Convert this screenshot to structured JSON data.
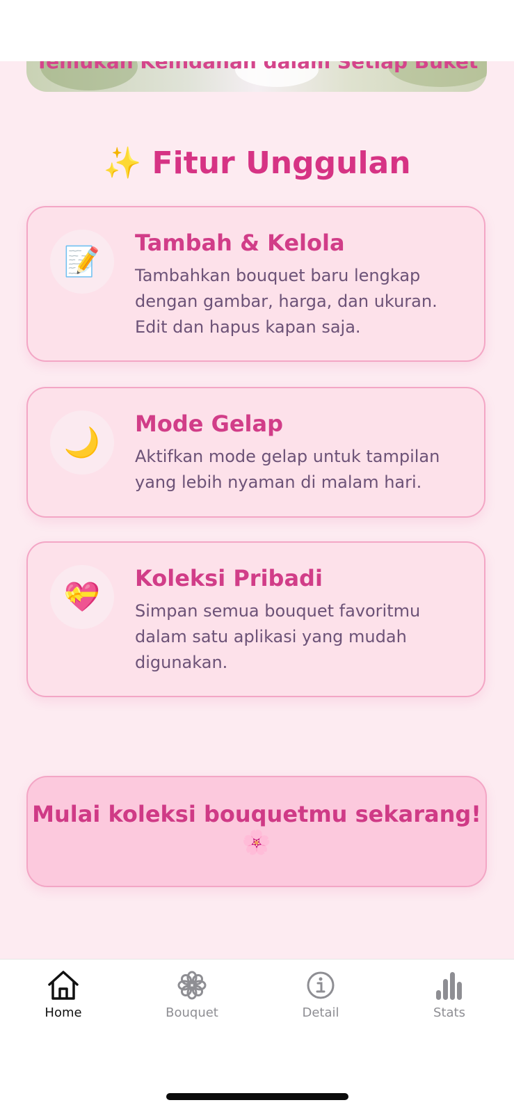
{
  "hero": {
    "text": "Temukan Keindahan dalam Setiap Buket"
  },
  "section": {
    "title": "✨ Fitur Unggulan"
  },
  "features": [
    {
      "icon": "📝",
      "icon_name": "memo-icon",
      "title": "Tambah & Kelola",
      "desc": "Tambahkan bouquet baru lengkap dengan gambar, harga, dan ukuran. Edit dan hapus kapan saja."
    },
    {
      "icon": "🌙",
      "icon_name": "crescent-moon-icon",
      "title": "Mode Gelap",
      "desc": "Aktifkan mode gelap untuk tampilan yang lebih nyaman di malam hari."
    },
    {
      "icon": "💝",
      "icon_name": "heart-ribbon-icon",
      "title": "Koleksi Pribadi",
      "desc": "Simpan semua bouquet favoritmu dalam satu aplikasi yang mudah digunakan."
    }
  ],
  "cta": {
    "text": "Mulai koleksi bouquetmu sekarang!",
    "emoji": "🌸"
  },
  "tabbar": {
    "tabs": [
      {
        "label": "Home",
        "icon": "home-icon",
        "active": true
      },
      {
        "label": "Bouquet",
        "icon": "flower-icon",
        "active": false
      },
      {
        "label": "Detail",
        "icon": "info-icon",
        "active": false
      },
      {
        "label": "Stats",
        "icon": "bar-chart-icon",
        "active": false
      }
    ]
  },
  "colors": {
    "accent": "#d63384",
    "background": "#fdebf1",
    "card": "#fde1ea",
    "text": "#6c5277"
  }
}
